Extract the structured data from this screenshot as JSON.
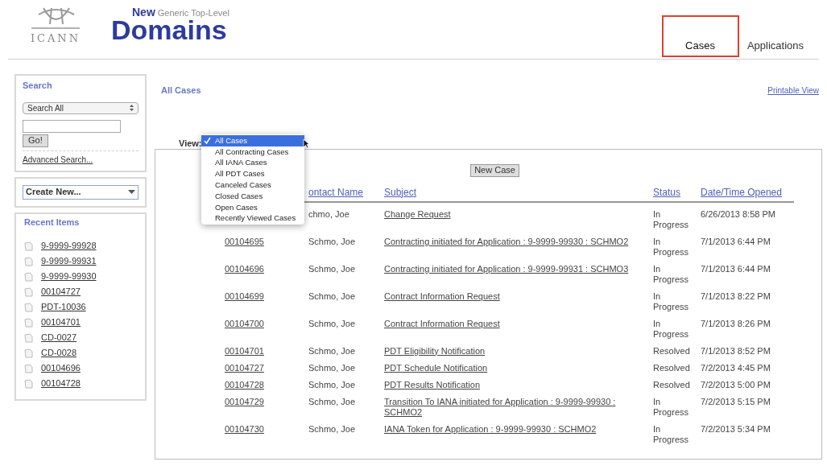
{
  "logo": {
    "org": "ICANN",
    "new": "New",
    "tagline": "Generic Top-Level",
    "title": "Domains"
  },
  "tabs": [
    {
      "label": "Cases",
      "selected": true,
      "highlighted": true
    },
    {
      "label": "Applications",
      "selected": false,
      "highlighted": false
    }
  ],
  "search": {
    "title": "Search",
    "scope": "Search All",
    "button": "Go!",
    "advanced": "Advanced Search..."
  },
  "create_new": "Create New...",
  "recent": {
    "title": "Recent Items",
    "items": [
      "9-9999-99928",
      "9-9999-99931",
      "9-9999-99930",
      "00104727",
      "PDT-10036",
      "00104701",
      "CD-0027",
      "CD-0028",
      "00104696",
      "00104728"
    ]
  },
  "page_title": "All Cases",
  "printable_view": "Printable View",
  "view": {
    "label": "View:",
    "options": [
      {
        "label": "All Cases",
        "selected": true
      },
      {
        "label": "All Contracting Cases",
        "selected": false
      },
      {
        "label": "All IANA Cases",
        "selected": false
      },
      {
        "label": "All PDT Cases",
        "selected": false
      },
      {
        "label": "Canceled Cases",
        "selected": false
      },
      {
        "label": "Closed Cases",
        "selected": false
      },
      {
        "label": "Open Cases",
        "selected": false
      },
      {
        "label": "Recently Viewed Cases",
        "selected": false
      }
    ]
  },
  "new_case": "New Case",
  "table": {
    "columns": [
      "ontact Name",
      "Subject",
      "Status",
      "Date/Time Opened"
    ],
    "rows": [
      {
        "case_number": "",
        "contact": "chmo, Joe",
        "subject": "Change Request",
        "status": "In Progress",
        "opened": "6/26/2013 8:58 PM"
      },
      {
        "case_number": "00104695",
        "contact": "Schmo, Joe",
        "subject": "Contracting initiated for Application : 9-9999-99930 : SCHMO2",
        "status": "In Progress",
        "opened": "7/1/2013 6:44 PM"
      },
      {
        "case_number": "00104696",
        "contact": "Schmo, Joe",
        "subject": "Contracting initiated for Application : 9-9999-99931 : SCHMO3",
        "status": "In Progress",
        "opened": "7/1/2013 6:44 PM"
      },
      {
        "case_number": "00104699",
        "contact": "Schmo, Joe",
        "subject": "Contract Information Request",
        "status": "In Progress",
        "opened": "7/1/2013 8:22 PM"
      },
      {
        "case_number": "00104700",
        "contact": "Schmo, Joe",
        "subject": "Contract Information Request",
        "status": "In Progress",
        "opened": "7/1/2013 8:26 PM"
      },
      {
        "case_number": "00104701",
        "contact": "Schmo, Joe",
        "subject": "PDT Eligibility Notification",
        "status": "Resolved",
        "opened": "7/1/2013 8:52 PM"
      },
      {
        "case_number": "00104727",
        "contact": "Schmo, Joe",
        "subject": "PDT Schedule Notification",
        "status": "Resolved",
        "opened": "7/2/2013 4:45 PM"
      },
      {
        "case_number": "00104728",
        "contact": "Schmo, Joe",
        "subject": "PDT Results Notification",
        "status": "Resolved",
        "opened": "7/2/2013 5:00 PM"
      },
      {
        "case_number": "00104729",
        "contact": "Schmo, Joe",
        "subject": "Transition To IANA initiated for Application : 9-9999-99930 : SCHMO2",
        "status": "In Progress",
        "opened": "7/2/2013 5:15 PM"
      },
      {
        "case_number": "00104730",
        "contact": "Schmo, Joe",
        "subject": "IANA Token for Application : 9-9999-99930 : SCHMO2",
        "status": "In Progress",
        "opened": "7/2/2013 5:34 PM"
      }
    ]
  }
}
